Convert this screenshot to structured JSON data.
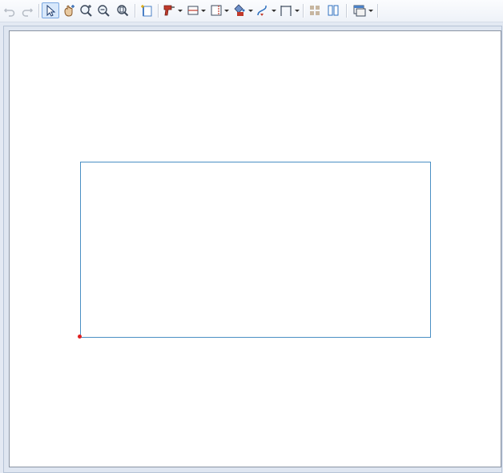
{
  "toolbar": {
    "items": [
      {
        "name": "undo",
        "icon": "undo-icon",
        "enabled": false
      },
      {
        "name": "redo",
        "icon": "redo-icon",
        "enabled": false
      },
      {
        "name": "select",
        "icon": "arrow-pointer-icon",
        "selected": true
      },
      {
        "name": "pan",
        "icon": "hand-pan-icon"
      },
      {
        "name": "zoom-in",
        "icon": "zoom-in-icon"
      },
      {
        "name": "zoom-out",
        "icon": "zoom-out-icon"
      },
      {
        "name": "zoom-fit",
        "icon": "zoom-fit-icon"
      },
      {
        "name": "new-sheet",
        "icon": "new-sheet-icon"
      },
      {
        "name": "drill",
        "icon": "drill-icon",
        "dropdown": true
      },
      {
        "name": "horizontal-split",
        "icon": "horizontal-split-icon",
        "dropdown": true
      },
      {
        "name": "vertical-split",
        "icon": "vertical-split-icon",
        "dropdown": true
      },
      {
        "name": "paint-fill",
        "icon": "paint-fill-icon",
        "dropdown": true
      },
      {
        "name": "curve",
        "icon": "curve-icon",
        "dropdown": true
      },
      {
        "name": "dimension",
        "icon": "dimension-icon",
        "dropdown": true
      },
      {
        "name": "grid",
        "icon": "grid-icon"
      },
      {
        "name": "columns",
        "icon": "columns-icon"
      },
      {
        "name": "window",
        "icon": "window-icon",
        "dropdown": true
      }
    ]
  },
  "colors": {
    "shape_stroke": "#4a8fc4",
    "anchor_point": "#e02020",
    "selected_bg": "#d8e8fb"
  }
}
